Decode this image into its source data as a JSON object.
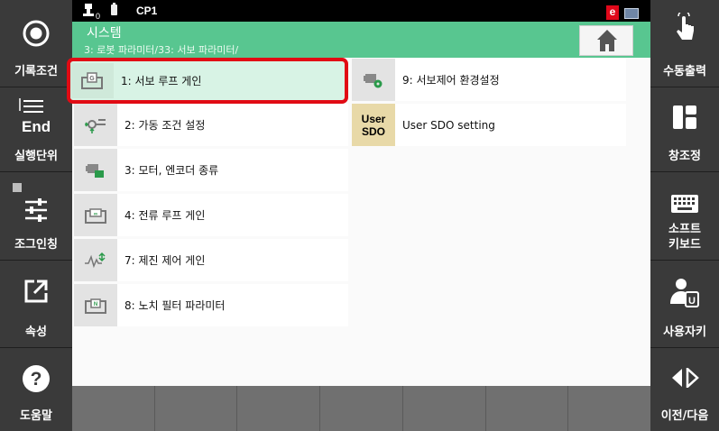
{
  "left_panel": [
    {
      "label": "기록조건",
      "icon": "record-circle-icon"
    },
    {
      "label": "실행단위",
      "icon": "end-step-icon",
      "icon_text": "End"
    },
    {
      "label": "조그인칭",
      "icon": "jog-sliders-icon"
    },
    {
      "label": "속성",
      "icon": "external-link-icon"
    },
    {
      "label": "도움말",
      "icon": "help-icon"
    }
  ],
  "right_panel": [
    {
      "label": "수동출력",
      "icon": "touch-hand-icon"
    },
    {
      "label": "창조정",
      "icon": "window-layout-icon"
    },
    {
      "label": "소프트\n키보드",
      "line1": "소프트",
      "line2": "키보드",
      "icon": "keyboard-icon"
    },
    {
      "label": "사용자키",
      "icon": "user-key-icon",
      "icon_text": "U"
    },
    {
      "label": "이전/다음",
      "icon": "prev-next-icon"
    }
  ],
  "status_bar": {
    "robot_index": "0",
    "cp": "CP1",
    "error_badge": "e"
  },
  "header": {
    "title": "시스템",
    "breadcrumb": "3: 로봇 파라미터/33: 서보 파라미터/"
  },
  "menu_items": [
    {
      "label": "1: 서보 루프 게인",
      "icon": "servo-loop-gain-icon",
      "selected": true
    },
    {
      "label": "2: 가동 조건 설정",
      "icon": "operation-condition-icon"
    },
    {
      "label": "3: 모터, 엔코더 종류",
      "icon": "motor-encoder-icon"
    },
    {
      "label": "4: 전류 루프 게인",
      "icon": "current-loop-gain-icon"
    },
    {
      "label": "7: 제진 제어 게인",
      "icon": "vibration-control-icon"
    },
    {
      "label": "8: 노치 필터 파라미터",
      "icon": "notch-filter-icon"
    },
    {
      "label": "9: 서보제어 환경설정",
      "icon": "servo-env-settings-icon"
    },
    {
      "label": "User SDO setting",
      "icon": "user-sdo-icon",
      "icon_line1": "User",
      "icon_line2": "SDO"
    }
  ],
  "colors": {
    "header_green": "#58c690",
    "selection_red": "#e10b14",
    "panel_gray": "#3a3a3a"
  }
}
